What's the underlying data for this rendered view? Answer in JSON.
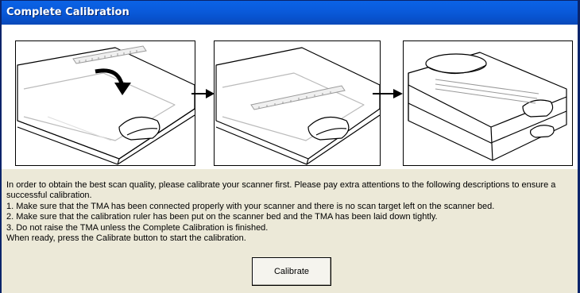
{
  "window": {
    "title": "Complete Calibration"
  },
  "steps": [
    {
      "name": "ruler-placed-on-scanner-bed"
    },
    {
      "name": "tma-laid-down"
    },
    {
      "name": "tma-closed"
    }
  ],
  "description": {
    "intro": "In order to obtain the best scan quality, please calibrate your scanner first. Please pay extra attentions to the following descriptions to ensure a successful calibration.",
    "items": [
      "1. Make sure that the TMA has been connected properly with your scanner and there is no scan target left on the scanner bed.",
      "2. Make sure that the calibration ruler has been put on the scanner bed and the TMA has been laid down tightly.",
      "3. Do not raise the TMA unless the Complete Calibration is finished."
    ],
    "ready": " When ready, press the Calibrate button to start the calibration."
  },
  "buttons": {
    "calibrate_label": "Calibrate"
  },
  "colors": {
    "titlebar": "#0a5bdc",
    "dialog_bg": "#ece9d8"
  },
  "icons": [
    "right-arrow-icon",
    "curved-arrow-icon"
  ]
}
